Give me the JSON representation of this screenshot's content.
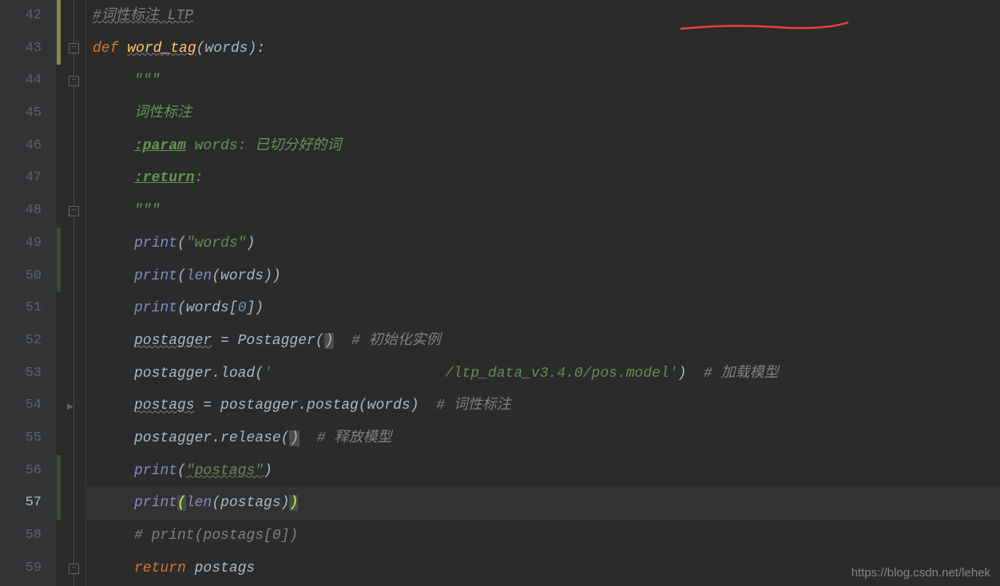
{
  "gutter": {
    "start": 42,
    "end": 59,
    "current": 57
  },
  "code": {
    "l42": {
      "comment": "#词性标注 LTP"
    },
    "l43": {
      "kw": "def ",
      "fn": "word_tag",
      "params": "(words):"
    },
    "l44": {
      "docstr": "\"\"\""
    },
    "l45": {
      "docstr": "词性标注"
    },
    "l46": {
      "tag": ":param",
      "rest": " words: 已切分好的词"
    },
    "l47": {
      "tag": ":return",
      "rest": ":"
    },
    "l48": {
      "docstr": "\"\"\""
    },
    "l49": {
      "call": "print",
      "open": "(",
      "str": "\"words\"",
      "close": ")"
    },
    "l50": {
      "call": "print",
      "open": "(",
      "inner": "len",
      "inner_open": "(",
      "arg": "words",
      "inner_close": ")",
      "close": ")"
    },
    "l51": {
      "call": "print",
      "open": "(",
      "arg": "words",
      "idx_open": "[",
      "idx": "0",
      "idx_close": "]",
      "close": ")"
    },
    "l52": {
      "lhs": "postagger",
      "eq": " = ",
      "rhs": "Postagger",
      "open": "(",
      "close": ")",
      "cmt": "  # 初始化实例"
    },
    "l53": {
      "obj": "postagger.load",
      "open": "(",
      "q1": "'",
      "obscured": "████████████████████",
      "path": "/ltp_data_v3.4.0/pos.model",
      "q2": "'",
      "close": ")",
      "cmt": "  # 加载模型"
    },
    "l54": {
      "lhs": "postags",
      "eq": " = ",
      "obj": "postagger.postag",
      "open": "(",
      "arg": "words",
      "close": ")",
      "cmt": "  # 词性标注"
    },
    "l55": {
      "obj": "postagger.release",
      "open": "(",
      "close": ")",
      "cmt": "  # 释放模型"
    },
    "l56": {
      "call": "print",
      "open": "(",
      "str": "\"postags\"",
      "close": ")"
    },
    "l57": {
      "call": "print",
      "open": "(",
      "inner": "len",
      "inner_open": "(",
      "arg": "postags",
      "inner_close": ")",
      "close": ")"
    },
    "l58": {
      "cmt": "# print(postags[0])"
    },
    "l59": {
      "kw": "return ",
      "val": "postags"
    }
  },
  "watermark": "https://blog.csdn.net/lehek"
}
